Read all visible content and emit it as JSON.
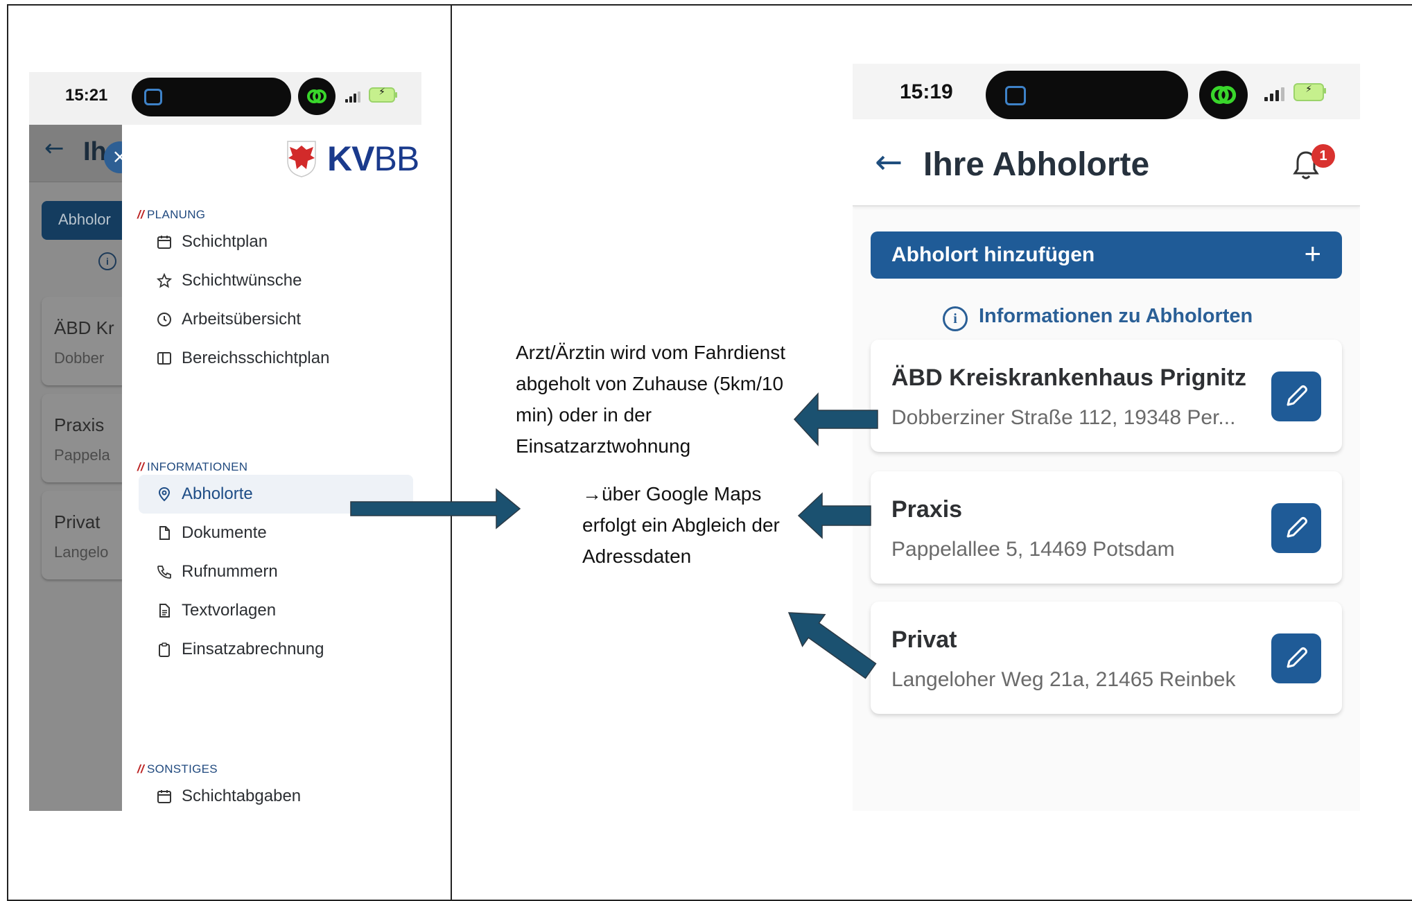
{
  "left_phone": {
    "status_time": "15:21",
    "background_app": {
      "title_fragment": "Ih",
      "button_fragment": "Abholor",
      "cards": [
        {
          "title": "ÄBD Kr",
          "subtitle": "Dobber"
        },
        {
          "title": "Praxis",
          "subtitle": "Pappela"
        },
        {
          "title": "Privat",
          "subtitle": "Langelo"
        }
      ]
    },
    "logo": {
      "kv": "KV",
      "bb": "BB"
    },
    "menu": {
      "sections": [
        {
          "label": "PLANUNG",
          "items": [
            "Schichtplan",
            "Schichtwünsche",
            "Arbeitsübersicht",
            "Bereichsschichtplan"
          ]
        },
        {
          "label": "INFORMATIONEN",
          "items": [
            "Abholorte",
            "Dokumente",
            "Rufnummern",
            "Textvorlagen",
            "Einsatzabrechnung"
          ]
        },
        {
          "label": "SONSTIGES",
          "items": [
            "Schichtabgaben"
          ]
        }
      ],
      "section_prefix": "//",
      "active_item": "Abholorte"
    }
  },
  "right_phone": {
    "status_time": "15:19",
    "title": "Ihre Abholorte",
    "notification_count": "1",
    "add_button": "Abholort hinzufügen",
    "add_symbol": "+",
    "info_link": "Informationen zu Abholorten",
    "locations": [
      {
        "title": "ÄBD Kreiskrankenhaus Prignitz",
        "address": "Dobberziner Straße 112, 19348 Per..."
      },
      {
        "title": "Praxis",
        "address": "Pappelallee 5, 14469 Potsdam"
      },
      {
        "title": "Privat",
        "address": "Langeloher Weg 21a, 21465 Reinbek"
      }
    ]
  },
  "annotations": {
    "note1": [
      "Arzt/Ärztin wird vom Fahrdienst",
      "abgeholt von Zuhause (5km/10",
      "min) oder in der",
      "Einsatzarztwohnung"
    ],
    "note2": [
      "→über Google Maps",
      "erfolgt ein Abgleich der",
      "Adressdaten"
    ]
  },
  "colors": {
    "accent": "#1f5b97",
    "arrow": "#1b5170",
    "badge": "#d9322f"
  }
}
